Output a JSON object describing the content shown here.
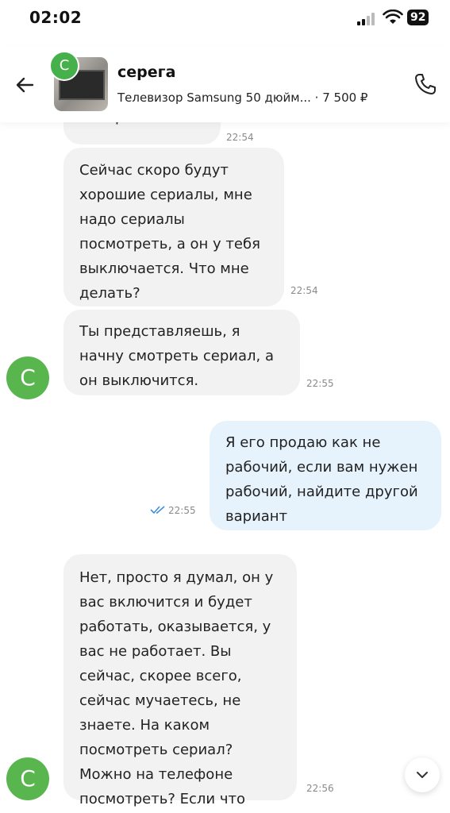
{
  "status": {
    "time": "02:02",
    "battery": "92"
  },
  "header": {
    "avatar_letter": "C",
    "name": "серега",
    "listing": "Телевизор Samsung 50 дюйм... · 7 500 ₽"
  },
  "messages": [
    {
      "direction": "in",
      "text": "смотреть?",
      "time": "22:54"
    },
    {
      "direction": "in",
      "text": "Сейчас скоро будут\nхорошие сериалы, мне\nнадо сериалы\nпосмотреть, а он у тебя\nвыключается. Что мне\nделать?",
      "time": "22:54"
    },
    {
      "direction": "in",
      "text": "Ты представляешь, я\nначну смотреть сериал, а\nон выключится.",
      "time": "22:55",
      "avatar": "C"
    },
    {
      "direction": "out",
      "text": "Я его продаю как не\nрабочий, если вам нужен\nрабочий, найдите другой\nвариант",
      "time": "22:55",
      "read_icon": "double-check-icon"
    },
    {
      "direction": "in",
      "text": "Нет, просто я думал, он у\nвас включится и будет\nработать, оказывается, у\nвас не работает. Вы\nсейчас, скорее всего,\nсейчас мучаетесь, не\nзнаете. На каком\nпосмотреть сериал?\nМожно на телефоне\nпосмотреть? Если что",
      "time": "22:56",
      "avatar": "C"
    }
  ],
  "colors": {
    "incoming": "#f2f2f2",
    "outgoing": "#e7f3fc",
    "avatar": "#59b54e",
    "read_check": "#3d8fe0"
  }
}
